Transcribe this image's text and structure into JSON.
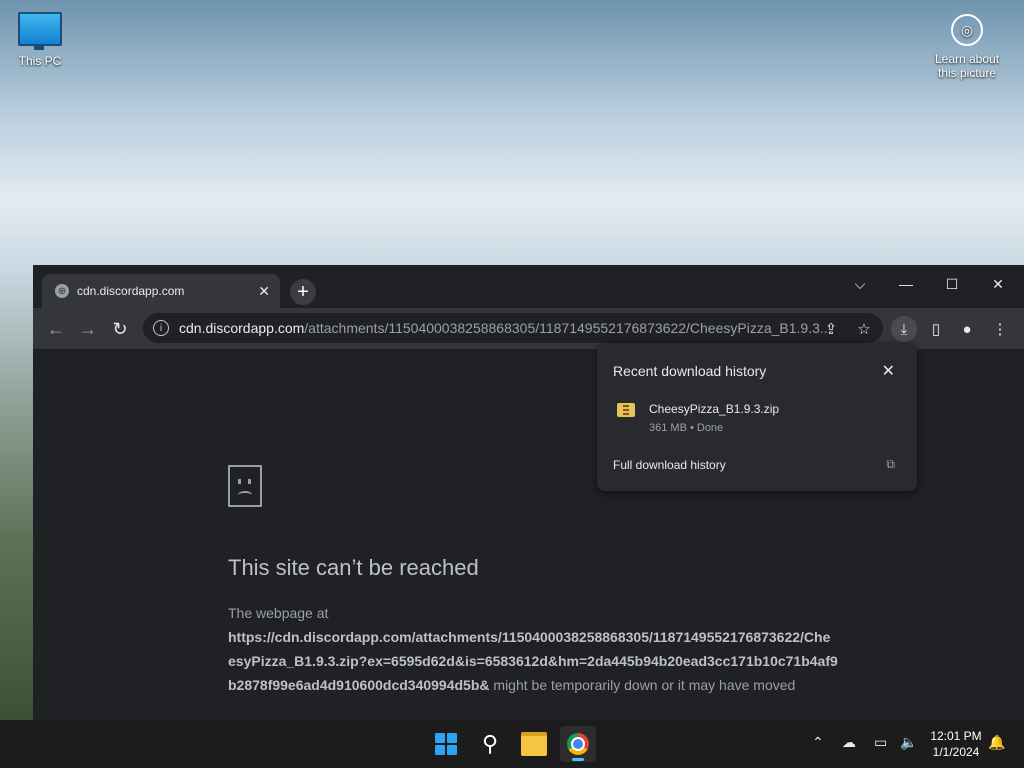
{
  "desktop": {
    "icon_label": "This PC",
    "learn_label_line1": "Learn about",
    "learn_label_line2": "this picture"
  },
  "browser": {
    "tab_title": "cdn.discordapp.com",
    "url_host": "cdn.discordapp.com",
    "url_path": "/attachments/1150400038258868305/1187149552176873622/CheesyPizza_B1.9.3...",
    "error": {
      "title": "This site can’t be reached",
      "body_prefix": "The webpage at",
      "url": "https://cdn.discordapp.com/attachments/1150400038258868305/1187149552176873622/CheesyPizza_B1.9.3.zip?ex=6595d62d&is=6583612d&hm=2da445b94b20ead3cc171b10c71b4af9b2878f99e6ad4d910600dcd340994d5b&",
      "body_suffix": "might be temporarily down or it may have moved"
    }
  },
  "downloads": {
    "title": "Recent download history",
    "file_name": "CheesyPizza_B1.9.3.zip",
    "file_meta": "361 MB • Done",
    "full_history": "Full download history"
  },
  "taskbar": {
    "time": "12:01 PM",
    "date": "1/1/2024"
  },
  "colors": {
    "browser_bg": "#202124",
    "toolbar_bg": "#35363a",
    "popup_bg": "#292a2d",
    "taskbar_bg": "#1c1c1c",
    "accent": "#4cc2ff"
  }
}
